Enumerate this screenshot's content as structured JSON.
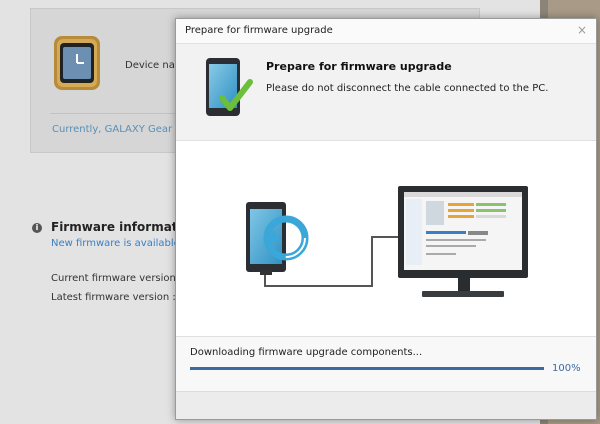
{
  "background": {
    "device_name_label": "Device nan",
    "current_device": "Currently, GALAXY Gear (E",
    "firmware_info_title": "Firmware information",
    "firmware_new_text": "New firmware is available.",
    "current_firmware_label": "Current firmware version :",
    "latest_firmware_label": "Latest firmware version :  F"
  },
  "dialog": {
    "title": "Prepare for firmware upgrade",
    "close_glyph": "×",
    "header_title": "Prepare for firmware upgrade",
    "header_message": "Please do not disconnect the cable connected to the PC."
  },
  "progress": {
    "label": "Downloading firmware upgrade components...",
    "value_fraction": 1.0,
    "percent_text": "100%"
  },
  "colors": {
    "accent": "#3b6aa0",
    "link": "#3a7fc4",
    "check_green": "#6bbf3a",
    "screen_blue": "#3aa7d8"
  },
  "icons": [
    "watch-icon",
    "info-icon",
    "phone-check-icon",
    "close-icon",
    "sync-phone-icon",
    "monitor-icon"
  ]
}
